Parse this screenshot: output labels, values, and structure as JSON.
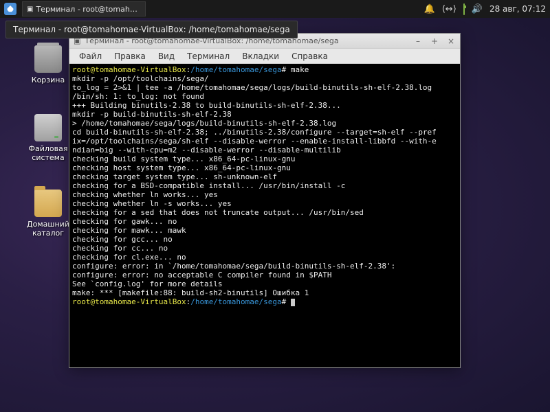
{
  "panel": {
    "taskbar_item": "Терминал - root@tomahom...",
    "clock": "28 авг, 07:12"
  },
  "tooltip": "Терминал - root@tomahomae-VirtualBox: /home/tomahomae/sega",
  "desktop": {
    "trash": "Корзина",
    "fs": "Файловая\nсистема",
    "home": "Домашний\nкаталог"
  },
  "window": {
    "title": "Терминал - root@tomahomae-VirtualBox: /home/tomahomae/sega",
    "menu": [
      "Файл",
      "Правка",
      "Вид",
      "Терминал",
      "Вкладки",
      "Справка"
    ]
  },
  "term": {
    "prompt1_user": "root@tomahomae-VirtualBox",
    "prompt1_path": "/home/tomahomae/sega",
    "prompt1_cmd": "make",
    "l2": "mkdir -p /opt/toolchains/sega/",
    "l3": "to_log = 2>&1 | tee -a /home/tomahomae/sega/logs/build-binutils-sh-elf-2.38.log",
    "l4": "/bin/sh: 1: to_log: not found",
    "l5": "+++ Building binutils-2.38 to build-binutils-sh-elf-2.38...",
    "l6": "mkdir -p build-binutils-sh-elf-2.38",
    "l7": "> /home/tomahomae/sega/logs/build-binutils-sh-elf-2.38.log",
    "l8": "cd build-binutils-sh-elf-2.38; ../binutils-2.38/configure --target=sh-elf --pref",
    "l9": "ix=/opt/toolchains/sega/sh-elf --disable-werror --enable-install-libbfd --with-e",
    "l10": "ndian=big --with-cpu=m2 --disable-werror --disable-multilib",
    "l11": "checking build system type... x86_64-pc-linux-gnu",
    "l12": "checking host system type... x86_64-pc-linux-gnu",
    "l13": "checking target system type... sh-unknown-elf",
    "l14": "checking for a BSD-compatible install... /usr/bin/install -c",
    "l15": "checking whether ln works... yes",
    "l16": "checking whether ln -s works... yes",
    "l17": "checking for a sed that does not truncate output... /usr/bin/sed",
    "l18": "checking for gawk... no",
    "l19": "checking for mawk... mawk",
    "l20": "checking for gcc... no",
    "l21": "checking for cc... no",
    "l22": "checking for cl.exe... no",
    "l23": "configure: error: in `/home/tomahomae/sega/build-binutils-sh-elf-2.38':",
    "l24": "configure: error: no acceptable C compiler found in $PATH",
    "l25": "See `config.log' for more details",
    "l26": "make: *** [makefile:88: build-sh2-binutils] Ошибка 1",
    "prompt2_user": "root@tomahomae-VirtualBox",
    "prompt2_path": "/home/tomahomae/sega"
  }
}
